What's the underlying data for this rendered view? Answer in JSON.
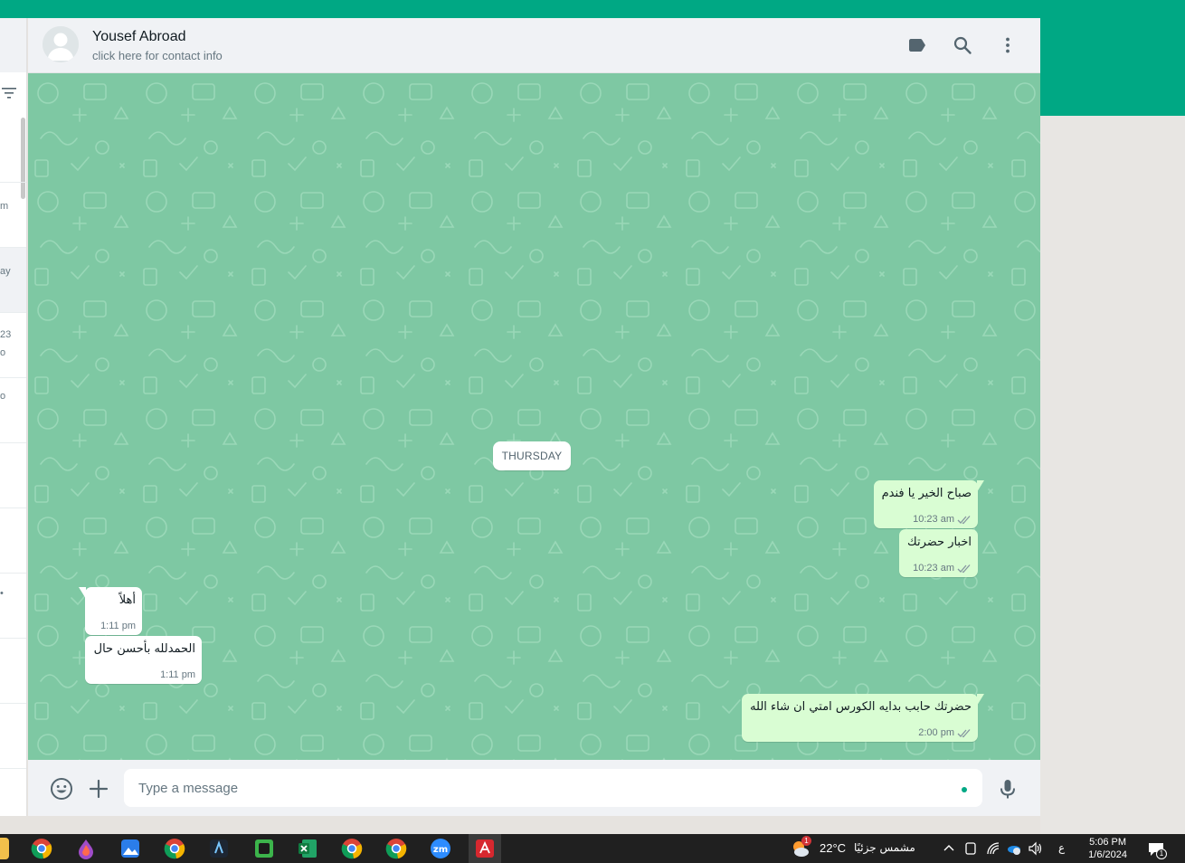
{
  "app": {
    "accent": "#00a884",
    "chat_bg": "#7ec8a3",
    "bubble_out": "#d9fdd3",
    "bubble_in": "#ffffff"
  },
  "sidebar": {
    "fragments": [
      "m",
      "ay",
      "23",
      "o",
      "o",
      "•"
    ]
  },
  "header": {
    "contact_name": "Yousef Abroad",
    "contact_sub": "click here for contact info",
    "icons": [
      "label-icon",
      "search-icon",
      "menu-dots-icon"
    ]
  },
  "chat": {
    "day_label": "THURSDAY",
    "messages": [
      {
        "dir": "out",
        "text": "صباح الخير يا فندم",
        "time": "10:23 am",
        "status": "read"
      },
      {
        "dir": "out",
        "text": "اخبار حضرتك",
        "time": "10:23 am",
        "status": "read"
      },
      {
        "dir": "in",
        "text": "أهلاً",
        "time": "1:11 pm"
      },
      {
        "dir": "in",
        "text": "الحمدلله بأحسن حال",
        "time": "1:11 pm"
      },
      {
        "dir": "out",
        "text": "حضرتك حابب بدايه الكورس امتي ان شاء الله",
        "time": "2:00 pm",
        "status": "read"
      }
    ]
  },
  "composer": {
    "placeholder": "Type a message",
    "icons": [
      "emoji-icon",
      "attach-plus-icon",
      "mic-icon"
    ]
  },
  "taskbar": {
    "weather_temp": "22°C",
    "weather_text": "مشمس جزئيًا",
    "weather_badge": "1",
    "lang": "ع",
    "time": "5:06 PM",
    "date": "1/6/2024",
    "notification_count": "1"
  }
}
